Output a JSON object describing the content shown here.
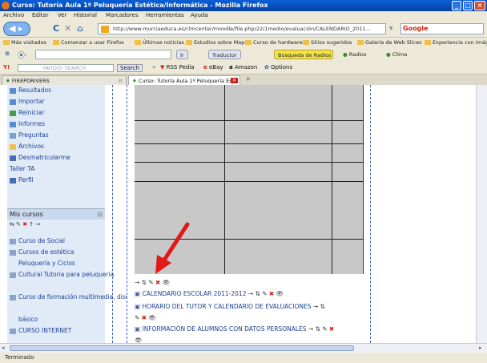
{
  "window": {
    "title": "Curso: Tutoría Aula 1º Peluquería Estética/Informática - Mozilla Firefox"
  },
  "menu": [
    "Archivo",
    "Editar",
    "Ver",
    "Historial",
    "Marcadores",
    "Herramientas",
    "Ayuda"
  ],
  "nav": {
    "url": "http://www.murciaeduca.es/clmcenter/moodle/file.php/22/1medio/evaluación/CALENDARIO_2011...",
    "search_engine": "Google",
    "search_placeholder": "Google"
  },
  "bookmarks": [
    "Más visitados",
    "Comenzar a usar Firefox",
    "Últimas noticias",
    "Estudios sobre Mapas",
    "Curso de hardware",
    "Sitios sugeridos",
    "Galería de Web Slices",
    "Experiencia con imágenes"
  ],
  "toolbar2": {
    "btn1": "Ir",
    "btn2": "Traductor",
    "btn3": "Búsqueda de Radios",
    "btn4": "Radios",
    "btn5": "Clima"
  },
  "toolbar3": {
    "brand": "YAHOO! SEARCH",
    "search_btn": "Search",
    "item1": "RSS Pedia",
    "item2": "eBay",
    "item3": "Amazon",
    "item4": "Options"
  },
  "tabs": [
    {
      "label": "FIREPDRIVERS"
    },
    {
      "label": "Curso: Tutoría Aula 1º Peluquería Est..."
    }
  ],
  "sidebar": {
    "items": [
      "Resultados",
      "Importar",
      "Reiniciar",
      "Informes",
      "Preguntas",
      "Archivos",
      "Desmatricularme",
      "Taller TA",
      "Perfil"
    ],
    "mis_cursos": "Mis cursos",
    "courses": [
      "Curso de Social",
      "Cursos de estética",
      "Peluquería y Ciclos",
      "Cultural Tutoria para peluquería",
      "Curso de formación multimedia, diseño",
      "básico",
      "CURSO INTERNET"
    ]
  },
  "content": {
    "links": [
      "CALENDARIO ESCOLAR 2011-2012",
      "HORARIO DEL TUTOR Y CALENDARIO DE EVALUACIONES",
      "INFORMACIÓN DE ALUMNOS CON DATOS PERSONALES"
    ]
  },
  "status": "Terminado"
}
